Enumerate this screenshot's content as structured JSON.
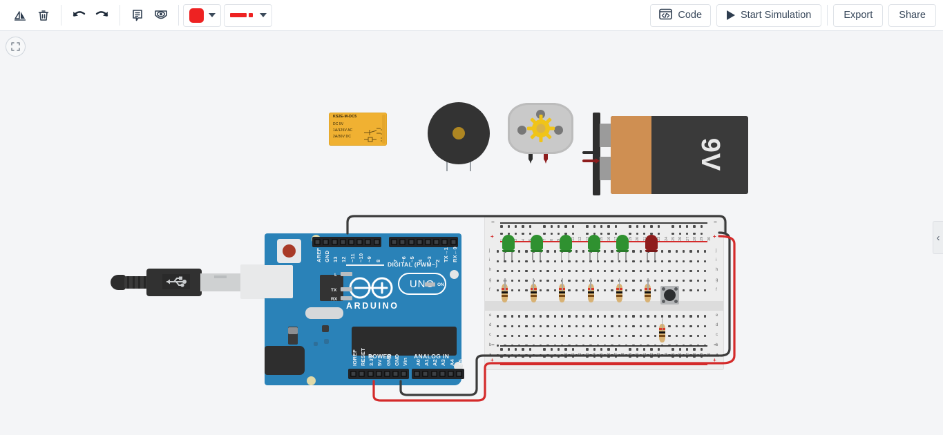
{
  "app": {
    "name": "Tinkercad Circuits",
    "canvas_bg": "#f4f5f7"
  },
  "toolbar": {
    "left_tools": [
      {
        "name": "rotate-icon",
        "label": "Rotate"
      },
      {
        "name": "delete-icon",
        "label": "Delete"
      },
      {
        "name": "undo-icon",
        "label": "Undo"
      },
      {
        "name": "redo-icon",
        "label": "Redo"
      },
      {
        "name": "notes-icon",
        "label": "Notes"
      },
      {
        "name": "eye-icon",
        "label": "Show/Hide"
      }
    ],
    "color_picker": {
      "name": "wire-color-picker",
      "value": "#ee2222",
      "label": "Wire color"
    },
    "wire_style_picker": {
      "name": "wire-style-picker",
      "value": "#ee2222",
      "label": "Wire style"
    },
    "code_label": "Code",
    "start_simulation_label": "Start Simulation",
    "export_label": "Export",
    "share_label": "Share"
  },
  "canvas_controls": {
    "fit_view_label": "Fit to view",
    "panel_toggle_label": "‹"
  },
  "components": {
    "relay": {
      "name": "relay-spdt",
      "title": "KS2E-M-DC5",
      "spec_1": "DC 5V",
      "spec_2": "1A/125V AC",
      "spec_3": "2A/30V DC",
      "body_color": "#f0b132"
    },
    "buzzer": {
      "name": "piezo-buzzer",
      "label": "Piezo",
      "body_color": "#333333",
      "hole_color": "#ae8622"
    },
    "motor": {
      "name": "dc-motor",
      "label": "DC Motor",
      "body_color": "#c9c9c9",
      "gear_color": "#f0c419"
    },
    "battery": {
      "name": "battery-9v",
      "label": "9V",
      "body_color": "#3a3a3a",
      "band_color": "#cf8f52"
    },
    "usb_cable": {
      "name": "usb-cable",
      "label": "USB Cable"
    },
    "arduino": {
      "name": "arduino-uno-r3",
      "brand": "ARDUINO",
      "model": "UNO",
      "board_color": "#2a82b8",
      "digital_group_label": "DIGITAL (PWM~)",
      "power_group_label": "POWER",
      "analog_group_label": "ANALOG IN",
      "digital_pins_left": [
        "AREF",
        "GND",
        "13",
        "12",
        "~11",
        "~10",
        "~9",
        "8"
      ],
      "digital_pins_right": [
        "7",
        "~6",
        "~5",
        "4",
        "~3",
        "2",
        "TX→1",
        "RX←0"
      ],
      "power_pins": [
        "IOREF",
        "RESET",
        "3.3V",
        "5V",
        "GND",
        "GND",
        "Vin"
      ],
      "analog_pins": [
        "A0",
        "A1",
        "A2",
        "A3",
        "A4",
        "A5"
      ],
      "indicator_leds": [
        "L",
        "TX",
        "RX"
      ],
      "power_led_label": "ON"
    },
    "breadboard": {
      "name": "breadboard-half-plus",
      "columns": [
        1,
        2,
        3,
        4,
        5,
        6,
        7,
        8,
        9,
        10,
        11,
        12,
        13,
        14,
        15,
        16,
        17,
        18,
        19,
        20,
        21,
        22,
        23,
        24,
        25,
        26,
        27,
        28,
        29,
        30
      ],
      "rows_upper": [
        "j",
        "i",
        "h",
        "g",
        "f"
      ],
      "rows_lower": [
        "e",
        "d",
        "c",
        "b",
        "a"
      ],
      "rail_positive": "+",
      "rail_negative": "−",
      "rail_positive_color": "#d42b2b",
      "rail_negative_color": "#3c3c3c"
    },
    "leds": [
      {
        "name": "led-green-1",
        "color": "#2f9130",
        "column": 2
      },
      {
        "name": "led-green-2",
        "color": "#2f9130",
        "column": 6
      },
      {
        "name": "led-green-3",
        "color": "#2f9130",
        "column": 10
      },
      {
        "name": "led-green-4",
        "color": "#2f9130",
        "column": 14
      },
      {
        "name": "led-green-5",
        "color": "#2f9130",
        "column": 18
      },
      {
        "name": "led-red-1",
        "color": "#8e1d1d",
        "column": 22
      }
    ],
    "resistors": [
      {
        "name": "resistor-1",
        "bands": [
          "#d83a2a",
          "#111111",
          "#7a4a16"
        ]
      },
      {
        "name": "resistor-2",
        "bands": [
          "#d83a2a",
          "#111111",
          "#7a4a16"
        ]
      },
      {
        "name": "resistor-3",
        "bands": [
          "#d83a2a",
          "#111111",
          "#7a4a16"
        ]
      },
      {
        "name": "resistor-4",
        "bands": [
          "#d83a2a",
          "#111111",
          "#7a4a16"
        ]
      },
      {
        "name": "resistor-5",
        "bands": [
          "#d83a2a",
          "#111111",
          "#7a4a16"
        ]
      },
      {
        "name": "resistor-6",
        "bands": [
          "#d83a2a",
          "#111111",
          "#7a4a16"
        ]
      },
      {
        "name": "resistor-7",
        "bands": [
          "#d83a2a",
          "#111111",
          "#7a4a16"
        ]
      }
    ],
    "pushbutton": {
      "name": "pushbutton",
      "label": "Pushbutton"
    },
    "wires": [
      {
        "name": "wire-gnd-to-rail",
        "color": "#3c3c3c"
      },
      {
        "name": "wire-5v-to-rail",
        "color": "#d42b2b"
      },
      {
        "name": "wire-rail-bridge-negative",
        "color": "#3c3c3c"
      },
      {
        "name": "wire-rail-bridge-positive",
        "color": "#d42b2b"
      }
    ]
  }
}
